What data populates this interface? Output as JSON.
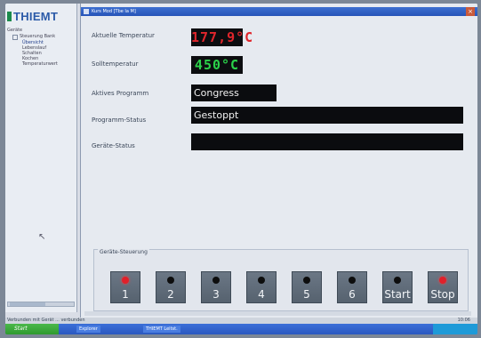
{
  "app": {
    "logo_text": "THIEMT",
    "window_title": "Kurs Mod [Tbe Ia M]"
  },
  "tree": {
    "root": "Geräte",
    "node": "Steuerung Bank",
    "leaves": [
      "Übersicht",
      "Lebenslauf",
      "Schalten",
      "Kochen",
      "Temperaturwert"
    ]
  },
  "fields": {
    "actual_temp_label": "Aktuelle Temperatur",
    "actual_temp_value": "177,9°C",
    "set_temp_label": "Solltemperatur",
    "set_temp_value": "450°C",
    "program_label": "Aktives Programm",
    "program_value": "Congress",
    "program_status_label": "Programm-Status",
    "program_status_value": "Gestoppt",
    "device_status_label": "Geräte-Status",
    "device_status_value": ""
  },
  "control": {
    "group_label": "Geräte-Steuerung",
    "buttons": [
      {
        "label": "1",
        "led": "red"
      },
      {
        "label": "2",
        "led": "black"
      },
      {
        "label": "3",
        "led": "black"
      },
      {
        "label": "4",
        "led": "black"
      },
      {
        "label": "5",
        "led": "black"
      },
      {
        "label": "6",
        "led": "black"
      },
      {
        "label": "Start",
        "led": "black"
      },
      {
        "label": "Stop",
        "led": "red"
      }
    ]
  },
  "statusbar": {
    "text": "Verbunden mit Gerät ... verbunden",
    "clock": "10:06"
  },
  "taskbar": {
    "start_label": "Start",
    "tasks": [
      "Explorer",
      "THIEMT Leitst."
    ]
  },
  "colors": {
    "actual_temp": "#e0262c",
    "set_temp": "#2bd24a"
  }
}
